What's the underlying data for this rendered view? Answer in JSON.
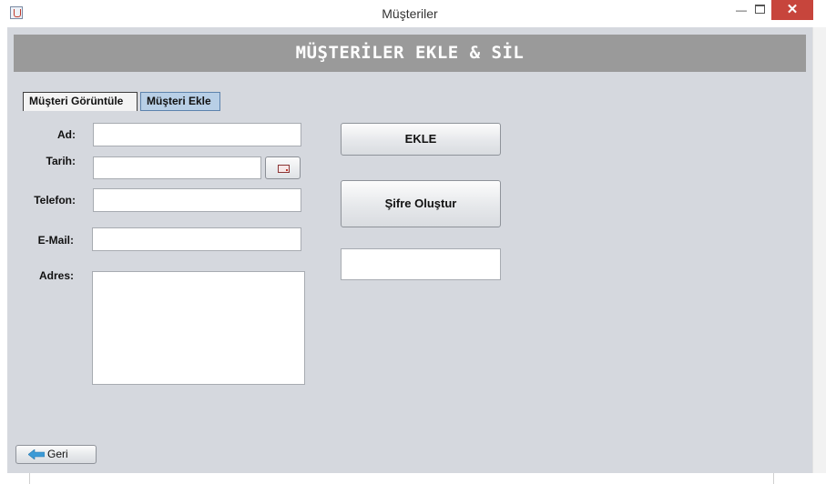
{
  "window": {
    "title": "Müşteriler",
    "minimize": "—",
    "close": "✕"
  },
  "header": {
    "title": "MÜŞTERİLER EKLE & SİL"
  },
  "tabs": [
    {
      "label": "Müşteri Görüntüle",
      "selected": false
    },
    {
      "label": "Müşteri Ekle",
      "selected": true
    }
  ],
  "form": {
    "ad_label": "Ad:",
    "tarih_label": "Tarih:",
    "telefon_label": "Telefon:",
    "email_label": "E-Mail:",
    "adres_label": "Adres:",
    "ad_value": "",
    "tarih_value": "",
    "telefon_value": "",
    "email_value": "",
    "adres_value": ""
  },
  "actions": {
    "ekle_label": "EKLE",
    "sifre_label": "Şifre Oluştur",
    "sifre_output": ""
  },
  "footer": {
    "back_label": "Geri"
  },
  "icons": {
    "app": "java-app-icon",
    "calendar": "calendar-icon",
    "back": "back-arrow-icon"
  },
  "colors": {
    "header_bg": "#9a9a9a",
    "panel_bg": "#d5d8de",
    "selected_tab": "#b8cfe6",
    "close_button": "#c7453c",
    "back_arrow": "#3c9ad6"
  }
}
